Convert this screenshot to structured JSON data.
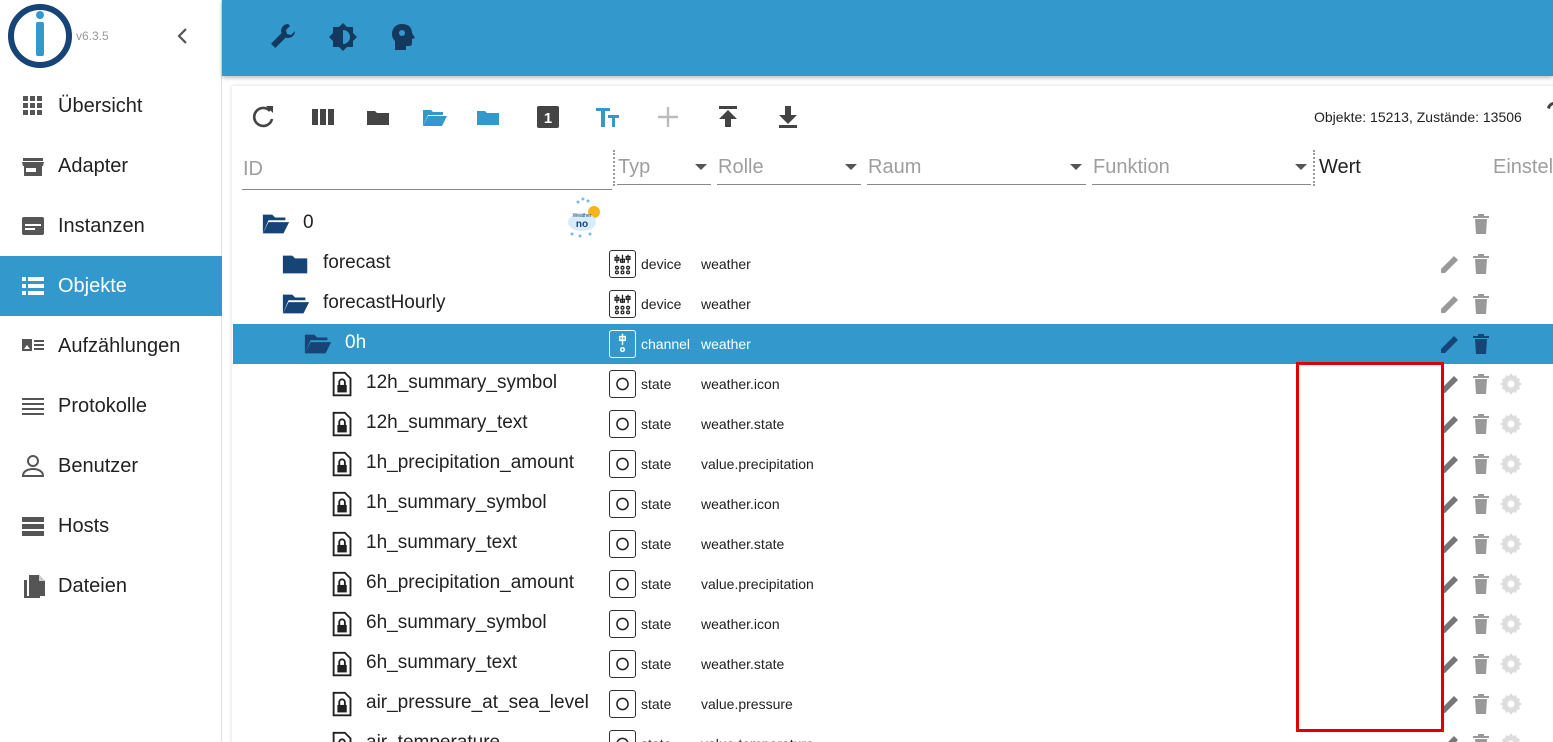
{
  "app": {
    "version": "v6.3.5",
    "colors": {
      "primary": "#3399cc",
      "folder_dark": "#164477",
      "highlight_box": "#e00000",
      "icon_grey": "#777777"
    }
  },
  "sidebar": {
    "items": [
      {
        "label": "Übersicht",
        "icon": "grid-icon"
      },
      {
        "label": "Adapter",
        "icon": "store-icon"
      },
      {
        "label": "Instanzen",
        "icon": "instances-icon"
      },
      {
        "label": "Objekte",
        "icon": "list-icon",
        "active": true
      },
      {
        "label": "Aufzählungen",
        "icon": "enum-icon"
      },
      {
        "label": "Protokolle",
        "icon": "log-icon"
      },
      {
        "label": "Benutzer",
        "icon": "user-icon"
      },
      {
        "label": "Hosts",
        "icon": "hosts-icon"
      },
      {
        "label": "Dateien",
        "icon": "files-icon"
      }
    ]
  },
  "header": {
    "buttons": [
      "wrench-icon",
      "theme-icon",
      "expert-mode-icon"
    ]
  },
  "toolbar": {
    "buttons": [
      "refresh-icon",
      "columns-icon",
      "folder-collapse-icon",
      "folder-open-icon",
      "folder-expand-icon",
      "level-1-icon",
      "text-size-icon",
      "add-icon",
      "upload-icon",
      "download-icon"
    ],
    "counts": "Objekte: 15213, Zustände: 13506"
  },
  "filters": {
    "id_placeholder": "ID",
    "typ_placeholder": "Typ",
    "rolle_placeholder": "Rolle",
    "raum_placeholder": "Raum",
    "funktion_placeholder": "Funktion",
    "wert_header": "Wert",
    "einstellungen_header": "Einstel"
  },
  "rows": [
    {
      "name": "0",
      "kind": "folder-open",
      "type": "",
      "role": ""
    },
    {
      "name": "forecast",
      "kind": "folder",
      "type": "device",
      "role": "weather"
    },
    {
      "name": "forecastHourly",
      "kind": "folder-open",
      "type": "device",
      "role": "weather"
    },
    {
      "name": "0h",
      "kind": "folder-open",
      "type": "channel",
      "role": "weather",
      "selected": true
    },
    {
      "name": "12h_summary_symbol",
      "kind": "state",
      "type": "state",
      "role": "weather.icon"
    },
    {
      "name": "12h_summary_text",
      "kind": "state",
      "type": "state",
      "role": "weather.state"
    },
    {
      "name": "1h_precipitation_amount",
      "kind": "state",
      "type": "state",
      "role": "value.precipitation"
    },
    {
      "name": "1h_summary_symbol",
      "kind": "state",
      "type": "state",
      "role": "weather.icon"
    },
    {
      "name": "1h_summary_text",
      "kind": "state",
      "type": "state",
      "role": "weather.state"
    },
    {
      "name": "6h_precipitation_amount",
      "kind": "state",
      "type": "state",
      "role": "value.precipitation"
    },
    {
      "name": "6h_summary_symbol",
      "kind": "state",
      "type": "state",
      "role": "weather.icon"
    },
    {
      "name": "6h_summary_text",
      "kind": "state",
      "type": "state",
      "role": "weather.state"
    },
    {
      "name": "air_pressure_at_sea_level",
      "kind": "state",
      "type": "state",
      "role": "value.pressure"
    },
    {
      "name": "air_temperature",
      "kind": "state",
      "type": "state",
      "role": "value.temperature"
    }
  ],
  "weather_logo": {
    "line1": "Weather",
    "line2": "no"
  }
}
